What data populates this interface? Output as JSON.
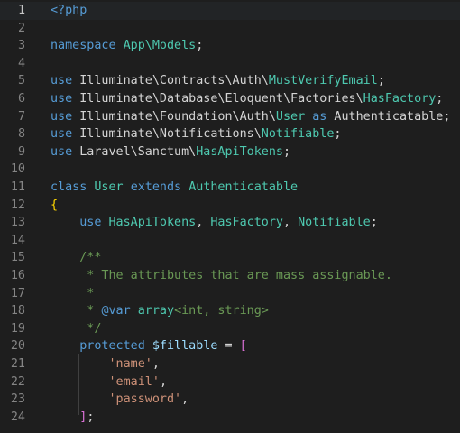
{
  "editor": {
    "language": "php",
    "theme_colors": {
      "background": "#1e1e1e",
      "keyword": "#569cd6",
      "class": "#4ec9b0",
      "string": "#ce9178",
      "comment": "#6a9955",
      "variable": "#9cdcfe"
    },
    "lines": [
      {
        "n": "1",
        "tokens": [
          {
            "t": "<?php",
            "c": "k-blue"
          }
        ]
      },
      {
        "n": "2",
        "tokens": []
      },
      {
        "n": "3",
        "tokens": [
          {
            "t": "namespace ",
            "c": "k-blue"
          },
          {
            "t": "App\\Models",
            "c": "k-ns"
          },
          {
            "t": ";",
            "c": "k-punc"
          }
        ]
      },
      {
        "n": "4",
        "tokens": []
      },
      {
        "n": "5",
        "tokens": [
          {
            "t": "use ",
            "c": "k-blue"
          },
          {
            "t": "Illuminate\\Contracts\\Auth\\",
            "c": "k-punc"
          },
          {
            "t": "MustVerifyEmail",
            "c": "k-ns"
          },
          {
            "t": ";",
            "c": "k-punc"
          }
        ]
      },
      {
        "n": "6",
        "tokens": [
          {
            "t": "use ",
            "c": "k-blue"
          },
          {
            "t": "Illuminate\\Database\\Eloquent\\Factories\\",
            "c": "k-punc"
          },
          {
            "t": "HasFactory",
            "c": "k-ns"
          },
          {
            "t": ";",
            "c": "k-punc"
          }
        ]
      },
      {
        "n": "7",
        "tokens": [
          {
            "t": "use ",
            "c": "k-blue"
          },
          {
            "t": "Illuminate\\Foundation\\Auth\\",
            "c": "k-punc"
          },
          {
            "t": "User",
            "c": "k-ns"
          },
          {
            "t": " as ",
            "c": "k-blue"
          },
          {
            "t": "Authenticatable",
            "c": "k-punc"
          },
          {
            "t": ";",
            "c": "k-punc"
          }
        ]
      },
      {
        "n": "8",
        "tokens": [
          {
            "t": "use ",
            "c": "k-blue"
          },
          {
            "t": "Illuminate\\Notifications\\",
            "c": "k-punc"
          },
          {
            "t": "Notifiable",
            "c": "k-ns"
          },
          {
            "t": ";",
            "c": "k-punc"
          }
        ]
      },
      {
        "n": "9",
        "tokens": [
          {
            "t": "use ",
            "c": "k-blue"
          },
          {
            "t": "Laravel\\Sanctum\\",
            "c": "k-punc"
          },
          {
            "t": "HasApiTokens",
            "c": "k-ns"
          },
          {
            "t": ";",
            "c": "k-punc"
          }
        ]
      },
      {
        "n": "10",
        "tokens": []
      },
      {
        "n": "11",
        "tokens": [
          {
            "t": "class ",
            "c": "k-blue"
          },
          {
            "t": "User ",
            "c": "k-ns"
          },
          {
            "t": "extends ",
            "c": "k-blue"
          },
          {
            "t": "Authenticatable",
            "c": "k-ns"
          }
        ]
      },
      {
        "n": "12",
        "tokens": [
          {
            "t": "{",
            "c": "k-yel"
          }
        ]
      },
      {
        "n": "13",
        "tokens": [
          {
            "t": "    use ",
            "c": "k-blue"
          },
          {
            "t": "HasApiTokens",
            "c": "k-ns"
          },
          {
            "t": ", ",
            "c": "k-punc"
          },
          {
            "t": "HasFactory",
            "c": "k-ns"
          },
          {
            "t": ", ",
            "c": "k-punc"
          },
          {
            "t": "Notifiable",
            "c": "k-ns"
          },
          {
            "t": ";",
            "c": "k-punc"
          }
        ]
      },
      {
        "n": "14",
        "tokens": []
      },
      {
        "n": "15",
        "tokens": [
          {
            "t": "    /**",
            "c": "k-com"
          }
        ]
      },
      {
        "n": "16",
        "tokens": [
          {
            "t": "     * The attributes that are mass assignable.",
            "c": "k-com"
          }
        ]
      },
      {
        "n": "17",
        "tokens": [
          {
            "t": "     *",
            "c": "k-com"
          }
        ]
      },
      {
        "n": "18",
        "tokens": [
          {
            "t": "     * ",
            "c": "k-com"
          },
          {
            "t": "@var ",
            "c": "k-blue"
          },
          {
            "t": "array",
            "c": "k-ns"
          },
          {
            "t": "<int, string>",
            "c": "k-com"
          }
        ]
      },
      {
        "n": "19",
        "tokens": [
          {
            "t": "     */",
            "c": "k-com"
          }
        ]
      },
      {
        "n": "20",
        "tokens": [
          {
            "t": "    protected ",
            "c": "k-blue"
          },
          {
            "t": "$fillable",
            "c": "k-var"
          },
          {
            "t": " = ",
            "c": "k-punc"
          },
          {
            "t": "[",
            "c": "k-bracket"
          }
        ]
      },
      {
        "n": "21",
        "tokens": [
          {
            "t": "        'name'",
            "c": "k-str"
          },
          {
            "t": ",",
            "c": "k-punc"
          }
        ]
      },
      {
        "n": "22",
        "tokens": [
          {
            "t": "        'email'",
            "c": "k-str"
          },
          {
            "t": ",",
            "c": "k-punc"
          }
        ]
      },
      {
        "n": "23",
        "tokens": [
          {
            "t": "        'password'",
            "c": "k-str"
          },
          {
            "t": ",",
            "c": "k-punc"
          }
        ]
      },
      {
        "n": "24",
        "tokens": [
          {
            "t": "    ",
            "c": "k-punc"
          },
          {
            "t": "]",
            "c": "k-bracket"
          },
          {
            "t": ";",
            "c": "k-punc"
          }
        ]
      }
    ]
  }
}
